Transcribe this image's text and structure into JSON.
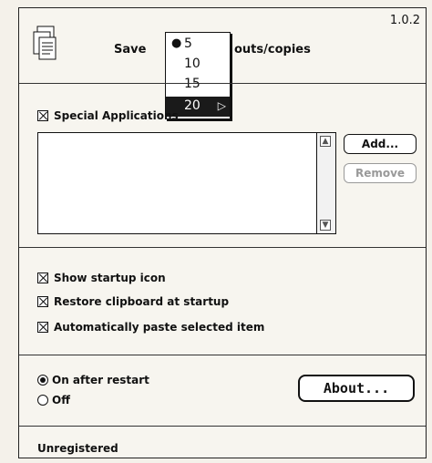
{
  "version": "1.0.2",
  "save": {
    "label": "Save",
    "suffix": "outs/copies"
  },
  "dropdown": {
    "items": [
      "5",
      "10",
      "15",
      "20"
    ],
    "current": "5",
    "highlighted": "20"
  },
  "special_apps": {
    "label": "Special Applications",
    "checked": true,
    "add_label": "Add...",
    "remove_label": "Remove"
  },
  "options": [
    {
      "label": "Show startup icon",
      "checked": true
    },
    {
      "label": "Restore clipboard at startup",
      "checked": true
    },
    {
      "label": "Automatically paste selected item",
      "checked": true
    }
  ],
  "restart": {
    "on_label": "On after restart",
    "off_label": "Off",
    "selected": "on"
  },
  "about_label": "About...",
  "status": "Unregistered"
}
